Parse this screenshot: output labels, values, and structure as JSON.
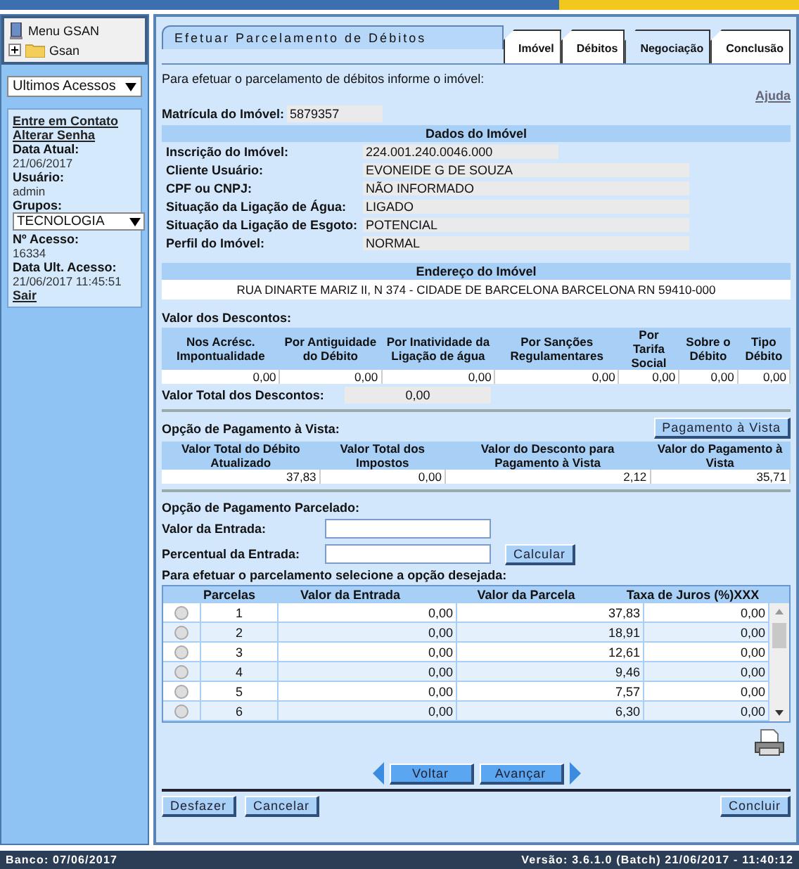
{
  "sidebar": {
    "menu_title": "Menu GSAN",
    "tree": [
      {
        "label": "Gsan",
        "expanded": false
      }
    ],
    "recent_select": "Ultimos Acessos",
    "links": [
      "Entre em Contato",
      "Alterar Senha"
    ],
    "info": [
      {
        "kind": "text",
        "label": "Data Atual:",
        "value": "21/06/2017"
      },
      {
        "kind": "text",
        "label": "Usuário:",
        "value": "admin"
      },
      {
        "kind": "select",
        "label": "Grupos:",
        "value": "TECNOLOGIA"
      },
      {
        "kind": "text",
        "label": "Nº Acesso:",
        "value": "16334"
      },
      {
        "kind": "text",
        "label": "Data Ult. Acesso:",
        "value": "21/06/2017 11:45:51"
      }
    ],
    "logout": "Sair"
  },
  "main": {
    "title": "Efetuar Parcelamento de Débitos",
    "tabs": [
      {
        "label": "Imóvel",
        "selected": false
      },
      {
        "label": "Débitos",
        "selected": false
      },
      {
        "label": "Negociação",
        "selected": true
      },
      {
        "label": "Conclusão",
        "selected": false
      }
    ],
    "intro": "Para efetuar o parcelamento de débitos informe o imóvel:",
    "help": "Ajuda",
    "matricula": {
      "label": "Matrícula do Imóvel:",
      "value": "5879357"
    },
    "dados": {
      "title": "Dados do Imóvel",
      "rows": [
        {
          "label": "Inscrição do Imóvel:",
          "value": "224.001.240.0046.000"
        },
        {
          "label": "Cliente Usuário:",
          "value": "EVONEIDE G DE SOUZA"
        },
        {
          "label": "CPF ou CNPJ:",
          "value": "NÃO INFORMADO"
        },
        {
          "label": "Situação da Ligação de Água:",
          "value": "LIGADO"
        },
        {
          "label": "Situação da Ligação de Esgoto:",
          "value": "POTENCIAL"
        },
        {
          "label": "Perfil do Imóvel:",
          "value": "NORMAL"
        }
      ]
    },
    "endereco": {
      "title": "Endereço do Imóvel",
      "value": "RUA DINARTE MARIZ II, N 374 - CIDADE DE BARCELONA BARCELONA RN 59410-000"
    },
    "descontos": {
      "label": "Valor dos Descontos:",
      "columns": [
        "Nos Acrésc. Impontualidade",
        "Por Antiguidade do Débito",
        "Por Inatividade da Ligação de água",
        "Por Sanções Regulamentares",
        "Por Tarifa Social",
        "Sobre o Débito",
        "Tipo Débito"
      ],
      "values": [
        "0,00",
        "0,00",
        "0,00",
        "0,00",
        "0,00",
        "0,00",
        "0,00"
      ],
      "total_label": "Valor Total dos Descontos:",
      "total_value": "0,00"
    },
    "vista": {
      "label": "Opção de Pagamento à Vista:",
      "button": "Pagamento à Vista",
      "columns": [
        "Valor Total do Débito Atualizado",
        "Valor Total dos Impostos",
        "Valor do Desconto para Pagamento à Vista",
        "Valor do Pagamento à Vista"
      ],
      "values": [
        "37,83",
        "0,00",
        "2,12",
        "35,71"
      ]
    },
    "parcelado": {
      "label": "Opção de Pagamento Parcelado:",
      "fields": [
        {
          "label": "Valor da Entrada:"
        },
        {
          "label": "Percentual da Entrada:"
        }
      ],
      "calc_button": "Calcular",
      "instruction": "Para efetuar o parcelamento selecione a opção desejada:",
      "columns": [
        "Parcelas",
        "Valor da Entrada",
        "Valor da Parcela",
        "Taxa de Juros (%)XXX"
      ],
      "rows": [
        {
          "selected": false,
          "cells": [
            "1",
            "0,00",
            "37,83",
            "0,00"
          ]
        },
        {
          "selected": false,
          "cells": [
            "2",
            "0,00",
            "18,91",
            "0,00"
          ]
        },
        {
          "selected": false,
          "cells": [
            "3",
            "0,00",
            "12,61",
            "0,00"
          ]
        },
        {
          "selected": false,
          "cells": [
            "4",
            "0,00",
            "9,46",
            "0,00"
          ]
        },
        {
          "selected": false,
          "cells": [
            "5",
            "0,00",
            "7,57",
            "0,00"
          ]
        },
        {
          "selected": false,
          "cells": [
            "6",
            "0,00",
            "6,30",
            "0,00"
          ]
        }
      ]
    },
    "nav": [
      "Voltar",
      "Avançar"
    ],
    "left_buttons": [
      "Desfazer",
      "Cancelar"
    ],
    "right_button": "Concluir"
  },
  "footer": {
    "left": "Banco: 07/06/2017",
    "right": "Versão: 3.6.1.0 (Batch) 21/06/2017 - 11:40:12"
  }
}
